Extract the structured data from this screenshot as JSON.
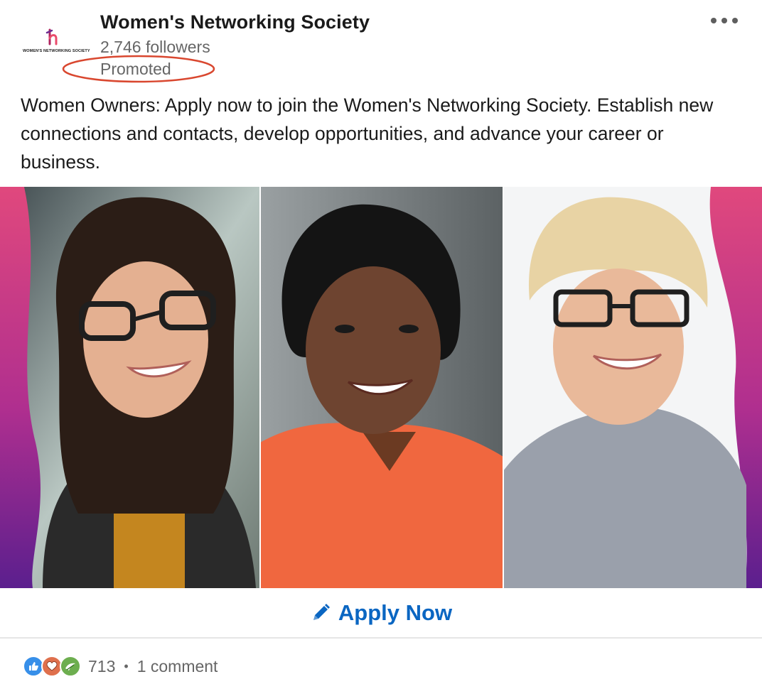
{
  "post": {
    "org_name": "Women's Networking Society",
    "followers": "2,746 followers",
    "promoted": "Promoted",
    "logo_text": "WOMEN'S NETWORKING SOCIETY",
    "body": "Women Owners: Apply now to join the Women's Networking Society. Establish new connections and contacts, develop opportunities, and advance your career or business.",
    "cta_label": "Apply Now",
    "reaction_icons": [
      "like-icon",
      "love-icon",
      "support-icon"
    ],
    "reaction_count": "713",
    "separator": "•",
    "comments": "1 comment"
  },
  "colors": {
    "brand_link": "#0a66c2",
    "annotation_ring": "#d9472f",
    "like": "#378fe9",
    "love": "#df704d",
    "support": "#6dae4f"
  }
}
